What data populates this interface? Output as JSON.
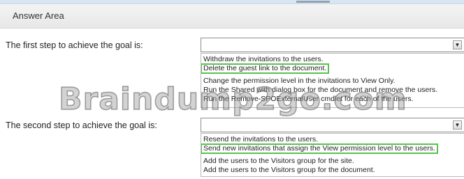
{
  "answer_area": {
    "title": "Answer Area"
  },
  "step1": {
    "label": "The first step to achieve the goal is:",
    "selected_value": "",
    "dropdown_arrow": "down-arrow-icon",
    "options": [
      "Withdraw the invitations to the users.",
      "Delete the guest link to the document.",
      "Change the permission level in the invitations to View Only.",
      "Run the Shared with dialog box for the document and remove the users.",
      "Run the Remove-SPOExternalUser cmdlet for each of the users."
    ],
    "highlighted_index": 1
  },
  "step2": {
    "label": "The second step to achieve the goal is:",
    "selected_value": "",
    "dropdown_arrow": "down-arrow-icon",
    "options": [
      "Resend the invitations to the users.",
      "Send new invitations that assign the View permission level to the users.",
      "Add the users to the Visitors group for the site.",
      "Add the users to the Visitors group for the document."
    ],
    "highlighted_index": 1
  },
  "watermark": {
    "text": "Braindump2go.com"
  },
  "colors": {
    "highlight_border": "#58c24e",
    "header_bg": "#ececec",
    "top_strip": "#d9e6f2"
  }
}
